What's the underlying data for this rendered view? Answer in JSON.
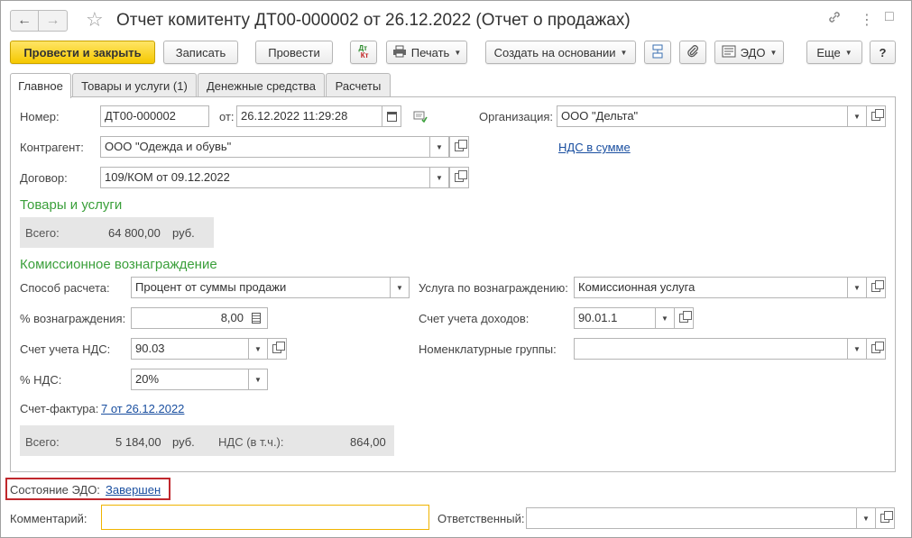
{
  "window": {
    "title": "Отчет комитенту ДТ00-000002 от 26.12.2022 (Отчет о продажах)",
    "back_icon": "arrow-left-icon",
    "forward_icon": "arrow-right-icon",
    "favorite_icon": "star-icon",
    "link_icon": "link-icon",
    "more_icon": "more-vertical-icon",
    "maximize_icon": "maximize-icon",
    "close_icon": "close-icon"
  },
  "toolbar": {
    "post_close": "Провести и закрыть",
    "save": "Записать",
    "post": "Провести",
    "dt_kt": "Дт Кт",
    "print": "Печать",
    "create_based": "Создать на основании",
    "edo": "ЭДО",
    "more": "Еще",
    "help": "?"
  },
  "tabs": [
    {
      "label": "Главное",
      "active": true
    },
    {
      "label": "Товары и услуги (1)",
      "active": false
    },
    {
      "label": "Денежные средства",
      "active": false
    },
    {
      "label": "Расчеты",
      "active": false
    }
  ],
  "header": {
    "number_label": "Номер:",
    "number_value": "ДТ00-000002",
    "date_label": "от:",
    "date_value": "26.12.2022 11:29:28",
    "org_label": "Организация:",
    "org_value": "ООО \"Дельта\"",
    "counterparty_label": "Контрагент:",
    "counterparty_value": "ООО \"Одежда и обувь\"",
    "vat_link": "НДС в сумме",
    "contract_label": "Договор:",
    "contract_value": "109/КОМ от 09.12.2022"
  },
  "goods": {
    "section_title": "Товары и услуги",
    "total_label": "Всего:",
    "total_value": "64 800,00",
    "currency": "руб."
  },
  "commission": {
    "section_title": "Комиссионное вознаграждение",
    "method_label": "Способ расчета:",
    "method_value": "Процент от суммы продажи",
    "service_label": "Услуга по вознаграждению:",
    "service_value": "Комиссионная услуга",
    "percent_label": "% вознаграждения:",
    "percent_value": "8,00",
    "income_account_label": "Счет учета доходов:",
    "income_account_value": "90.01.1",
    "vat_account_label": "Счет учета НДС:",
    "vat_account_value": "90.03",
    "nomenclature_label": "Номенклатурные группы:",
    "nomenclature_value": "",
    "vat_rate_label": "% НДС:",
    "vat_rate_value": "20%",
    "invoice_label": "Счет-фактура:",
    "invoice_link": "7 от 26.12.2022",
    "total_label": "Всего:",
    "total_value": "5 184,00",
    "currency": "руб.",
    "vat_incl_label": "НДС (в т.ч.):",
    "vat_incl_value": "864,00"
  },
  "footer": {
    "edo_state_label": "Состояние ЭДО:",
    "edo_state_link": "Завершен",
    "comment_label": "Комментарий:",
    "comment_value": "",
    "responsible_label": "Ответственный:",
    "responsible_value": ""
  },
  "colors": {
    "primary_button": "#f5c800",
    "section_green": "#3a9f3a",
    "link_blue": "#1a4fa0",
    "highlight_red": "#c0282d",
    "comment_border": "#f0b400"
  }
}
